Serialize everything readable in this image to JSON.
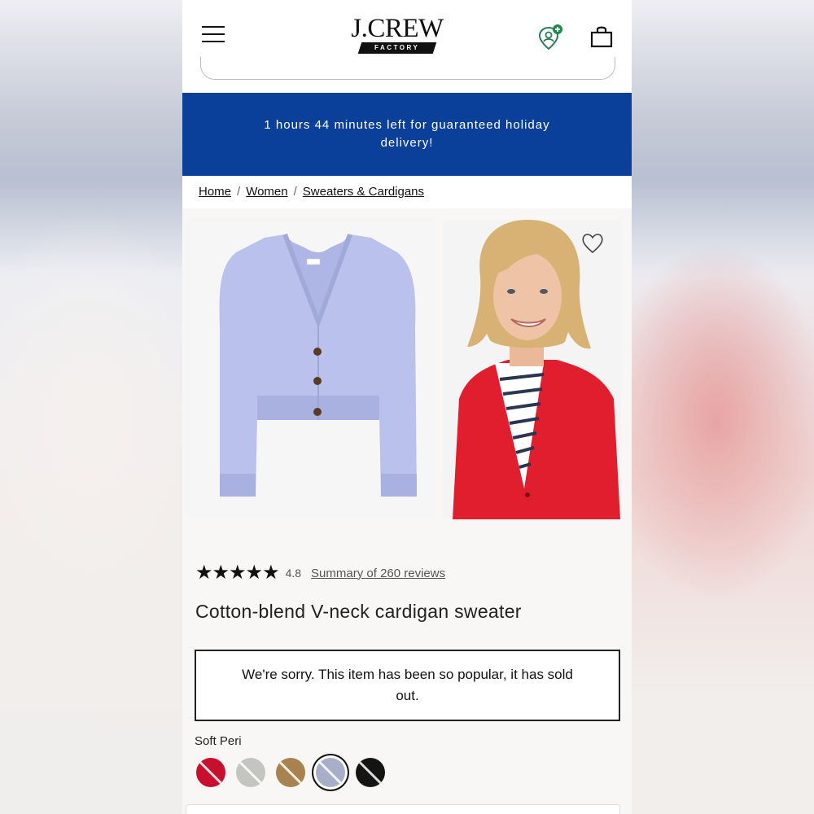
{
  "header": {
    "brand": "J.CREW",
    "brand_sub": "FACTORY"
  },
  "promo": {
    "text": "1 hours 44 minutes left for guaranteed holiday delivery!",
    "background": "#0a3f9a"
  },
  "breadcrumb": [
    {
      "label": "Home"
    },
    {
      "label": "Women"
    },
    {
      "label": "Sweaters & Cardigans"
    }
  ],
  "product": {
    "rating_stars": "★★★★★",
    "rating": "4.8",
    "reviews_link": "Summary of 260 reviews",
    "title": "Cotton-blend V-neck cardigan sweater",
    "soldout_message": "We're sorry. This item has been so popular, it has sold out.",
    "selected_color": "Soft Peri",
    "swatches": [
      {
        "color": "#c8102e",
        "selected": false
      },
      {
        "color": "#c4c4c0",
        "selected": false
      },
      {
        "color": "#a8824f",
        "selected": false
      },
      {
        "color": "#a9aec8",
        "selected": true
      },
      {
        "color": "#141414",
        "selected": false
      }
    ]
  },
  "icons": {
    "menu": "hamburger-icon",
    "account": "account-icon",
    "bag": "shopping-bag-icon",
    "wishlist": "heart-icon"
  }
}
